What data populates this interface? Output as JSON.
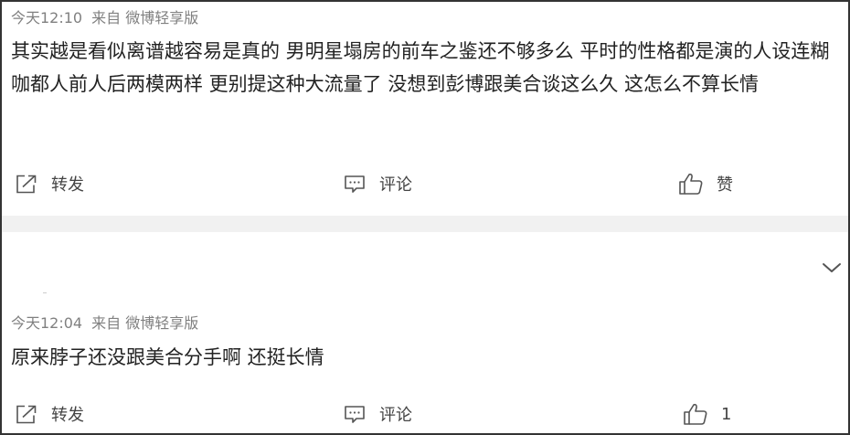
{
  "posts": [
    {
      "time": "今天12:10",
      "source": "来自 微博轻享版",
      "content": "其实越是看似离谱越容易是真的 男明星塌房的前车之鉴还不够多么 平时的性格都是演的人设连糊咖都人前人后两模两样 更别提这种大流量了 没想到彭博跟美合谈这么久 这怎么不算长情",
      "actions": {
        "share": "转发",
        "comment": "评论",
        "like": "赞"
      }
    },
    {
      "time": "今天12:04",
      "source": "来自 微博轻享版",
      "content": "原来脖子还没跟美合分手啊 还挺长情",
      "actions": {
        "share": "转发",
        "comment": "评论",
        "like": "1"
      }
    }
  ],
  "icons": {
    "share": "share-icon",
    "comment": "comment-icon",
    "like": "thumbs-up-icon",
    "fold": "chevron-down-icon"
  },
  "colors": {
    "meta_text": "#808080",
    "body_text": "#222222",
    "action_text": "#444444",
    "separator": "#f1f1f1",
    "border": "#333333"
  }
}
